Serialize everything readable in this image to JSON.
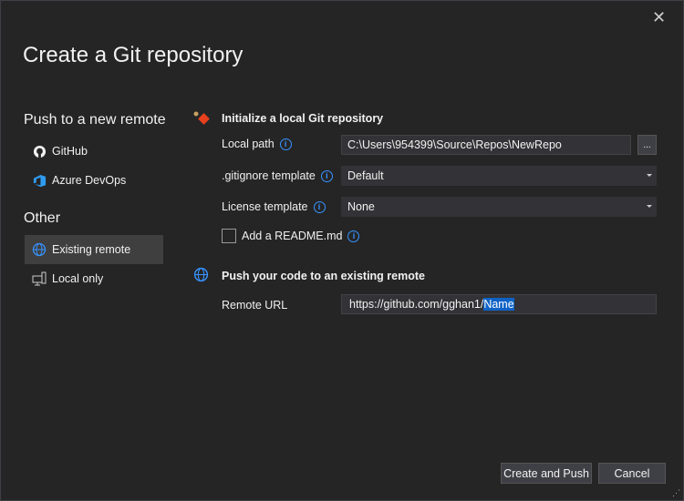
{
  "dialog": {
    "title": "Create a Git repository",
    "close_icon": "close-icon"
  },
  "sidebar": {
    "section1": "Push to a new remote",
    "items1": [
      {
        "label": "GitHub",
        "icon": "github-icon"
      },
      {
        "label": "Azure DevOps",
        "icon": "azure-devops-icon"
      }
    ],
    "section2": "Other",
    "items2": [
      {
        "label": "Existing remote",
        "icon": "globe-icon",
        "selected": true
      },
      {
        "label": "Local only",
        "icon": "computer-icon"
      }
    ]
  },
  "init": {
    "heading": "Initialize a local Git repository",
    "local_path_label": "Local path",
    "local_path_value": "C:\\Users\\954399\\Source\\Repos\\NewRepo",
    "browse_label": "...",
    "gitignore_label": ".gitignore template",
    "gitignore_value": "Default",
    "license_label": "License template",
    "license_value": "None",
    "readme_label": "Add a README.md",
    "readme_checked": false
  },
  "remote": {
    "heading": "Push your code to an existing remote",
    "url_label": "Remote URL",
    "url_prefix": "https://github.com/gghan1/",
    "url_selected": "Name"
  },
  "footer": {
    "create_label": "Create and Push",
    "cancel_label": "Cancel"
  },
  "colors": {
    "accent": "#3794ff",
    "selection": "#0e62c5",
    "background": "#252526"
  }
}
